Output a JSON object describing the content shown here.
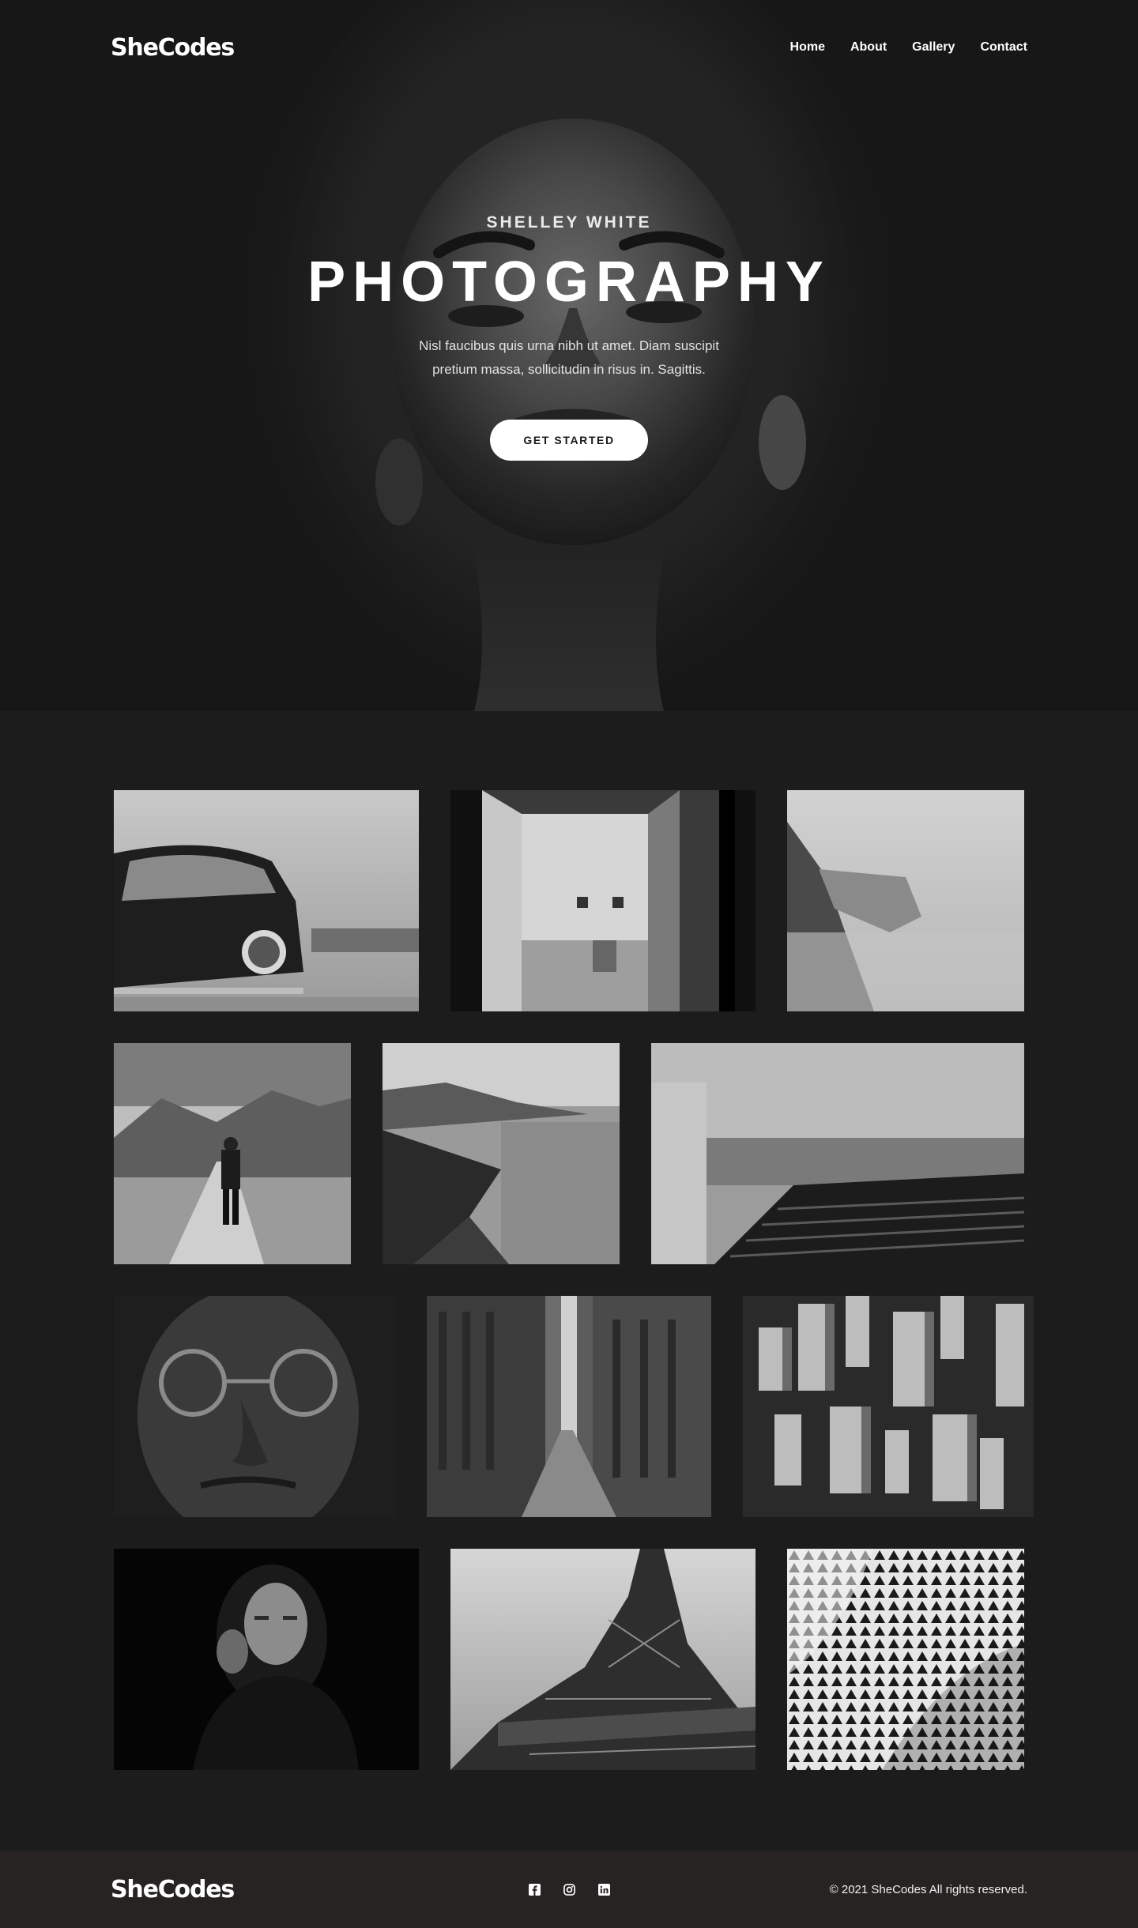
{
  "brand": {
    "logo": "SheCodes"
  },
  "nav": {
    "items": [
      "Home",
      "About",
      "Gallery",
      "Contact"
    ]
  },
  "hero": {
    "kicker": "SHELLEY WHITE",
    "title": "PHOTOGRAPHY",
    "text": "Nisl faucibus quis urna nibh ut amet. Diam suscipit pretium massa, sollicitudin in risus in. Sagittis.",
    "cta": "GET STARTED"
  },
  "gallery": {
    "photos": [
      "vintage-car-photo",
      "gallery-hallway-photo",
      "sea-cliff-photo",
      "desert-road-man-photo",
      "lake-coast-photo",
      "concrete-stairs-photo",
      "man-glasses-portrait-photo",
      "city-street-photo",
      "aerial-skyscrapers-photo",
      "woman-portrait-photo",
      "eiffel-tower-photo",
      "patterned-facade-photo"
    ]
  },
  "footer": {
    "logo": "SheCodes",
    "socials": [
      "facebook-icon",
      "instagram-icon",
      "linkedin-icon"
    ],
    "copyright": "© 2021 SheCodes All rights reserved."
  },
  "colors": {
    "background": "#1c1c1c",
    "footer": "#262322",
    "text": "#ffffff",
    "button": "#ffffff"
  }
}
